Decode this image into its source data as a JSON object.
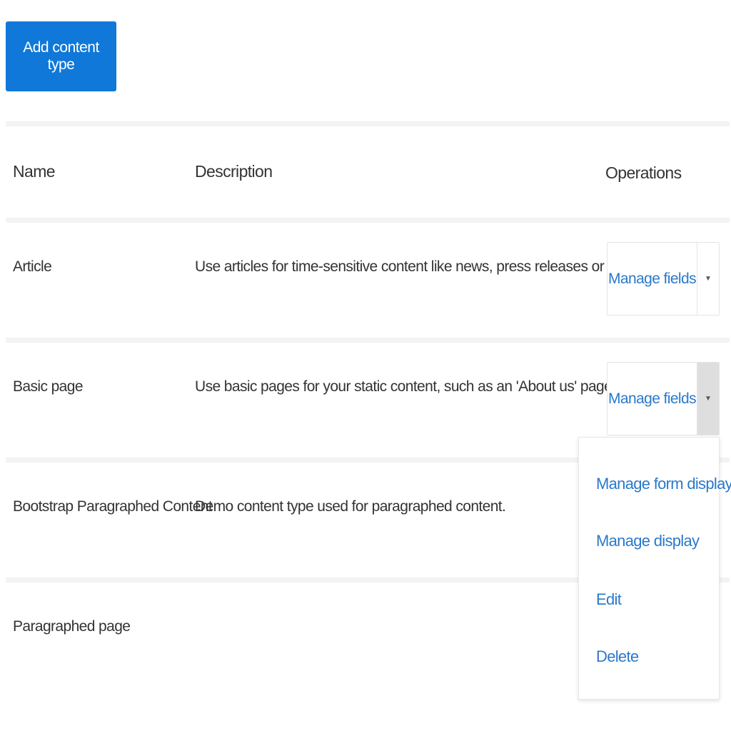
{
  "toolbar": {
    "add_label": "Add content type"
  },
  "table": {
    "headers": {
      "name": "Name",
      "description": "Description",
      "operations": "Operations"
    },
    "rows": [
      {
        "name": "Article",
        "description": "Use articles for time-sensitive content like news, press releases or blog posts.",
        "operation_label": "Manage fields"
      },
      {
        "name": "Basic page",
        "description": "Use basic pages for your static content, such as an 'About us' page.",
        "operation_label": "Manage fields"
      },
      {
        "name": "Bootstrap Paragraphed Content",
        "description": "Demo content type used for paragraphed content."
      },
      {
        "name": "Paragraphed page",
        "description": ""
      }
    ]
  },
  "dropdown": {
    "items": [
      "Manage form display",
      "Manage display",
      "Edit",
      "Delete"
    ]
  },
  "icons": {
    "toggle": "caret-down-icon"
  },
  "colors": {
    "primary_button": "#0f78d8",
    "link": "#2a79c9",
    "separator": "#f3f3f3"
  }
}
